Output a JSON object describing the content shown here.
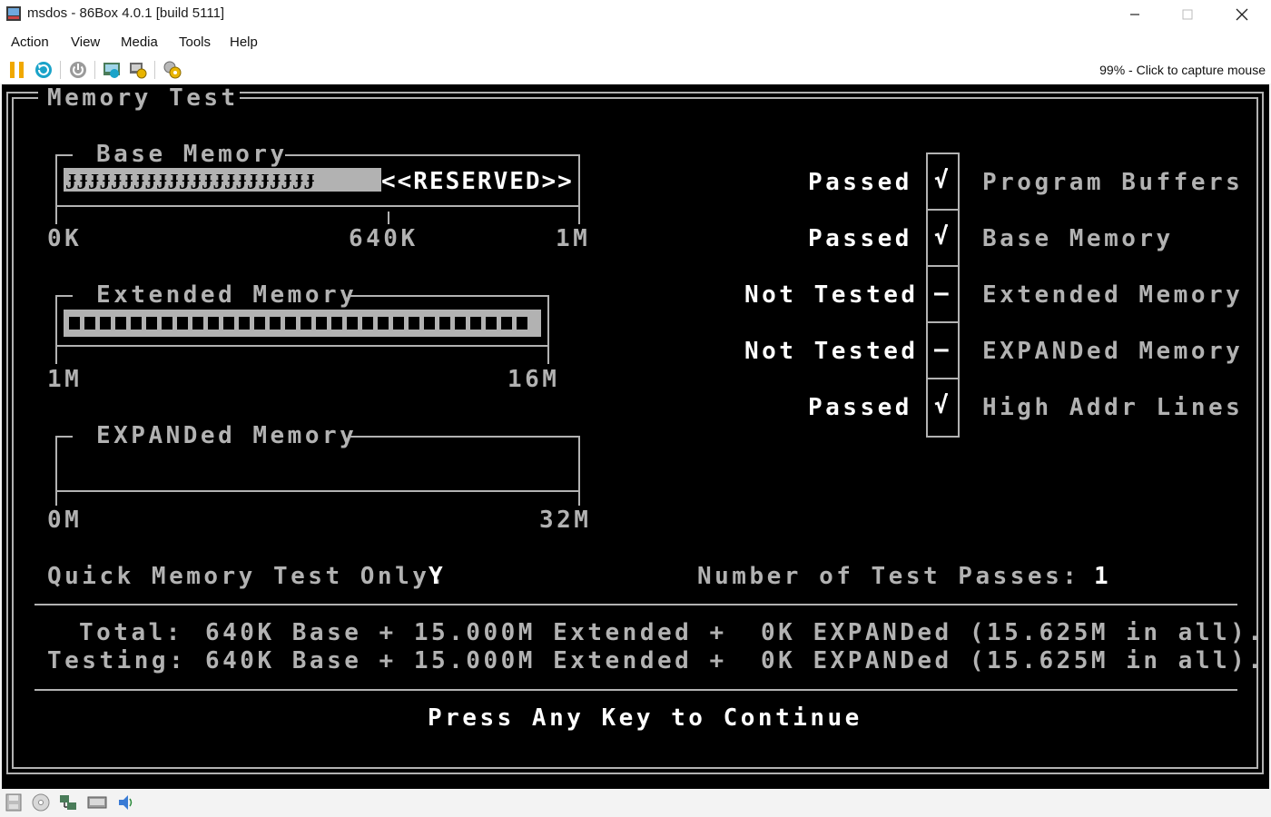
{
  "window": {
    "title": "msdos - 86Box 4.0.1 [build 5111]"
  },
  "menu": [
    "Action",
    "View",
    "Media",
    "Tools",
    "Help"
  ],
  "toolbar": {
    "status_hint": "99% - Click to capture mouse"
  },
  "dos": {
    "frame_title": "Memory Test",
    "base": {
      "title": "Base Memory",
      "bar_fill": "ɈɈɈɈɈɈɈɈɈɈɈɈɈɈɈɈɈɈɈɈɈɈ",
      "reserved": "<<RESERVED>>",
      "fill_fraction": 0.625,
      "label_start": "0K",
      "label_mid": "640K",
      "label_end": "1M"
    },
    "extended": {
      "title": "Extended Memory",
      "bar_fill": "▪▪▪▪▪▪▪▪▪▪▪▪▪▪▪▪▪▪▪▪▪▪▪▪▪▪▪▪▪▪▪▪▪▪▪▪▪▪▪▪▪▪▪▪▪▪▪▪▪▪▪▪▪▪▪▪▪▪▪▪▪▪▪▪▪▪▪▪▪▪▪▪▪▪▪▪▪▪▪▪▪▪▪▪",
      "label_start": "1M",
      "label_end": "16M"
    },
    "expanded": {
      "title": "EXPANDed Memory",
      "label_start": "0M",
      "label_end": "32M"
    },
    "results": [
      {
        "status": "Passed",
        "mark": "√",
        "name": "Program Buffers"
      },
      {
        "status": "Passed",
        "mark": "√",
        "name": "Base Memory"
      },
      {
        "status": "Not Tested",
        "mark": "–",
        "name": "Extended Memory"
      },
      {
        "status": "Not Tested",
        "mark": "–",
        "name": "EXPANDed Memory"
      },
      {
        "status": "Passed",
        "mark": "√",
        "name": "High Addr Lines"
      }
    ],
    "quick_label": "Quick Memory Test Only:",
    "quick_value": "Y",
    "passes_label": "Number of Test Passes:",
    "passes_value": "1",
    "total_label": "Total:",
    "total_text": "640K Base + 15.000M Extended +",
    "total_exp": "0K EXPANDed (15.625M in all).",
    "testing_label": "Testing:",
    "testing_text": "640K Base + 15.000M Extended +",
    "testing_exp": "0K EXPANDed (15.625M in all).",
    "continue": "Press Any Key to Continue"
  },
  "colors": {
    "screen_bg": "#000000",
    "gray_text": "#b2b2b2",
    "white_text": "#ffffff",
    "chrome_bg": "#ffffff",
    "statusbar_bg": "#f3f3f3"
  },
  "icons": {
    "toolbar": [
      "pause-icon",
      "reset-icon",
      "power-icon",
      "ctrl-alt-del-icon",
      "settings-gear-icon",
      "machine-settings-icon"
    ],
    "statusbar": [
      "floppy-icon",
      "cdrom-icon",
      "network-icon",
      "hard-disk-icon",
      "sound-icon"
    ]
  }
}
